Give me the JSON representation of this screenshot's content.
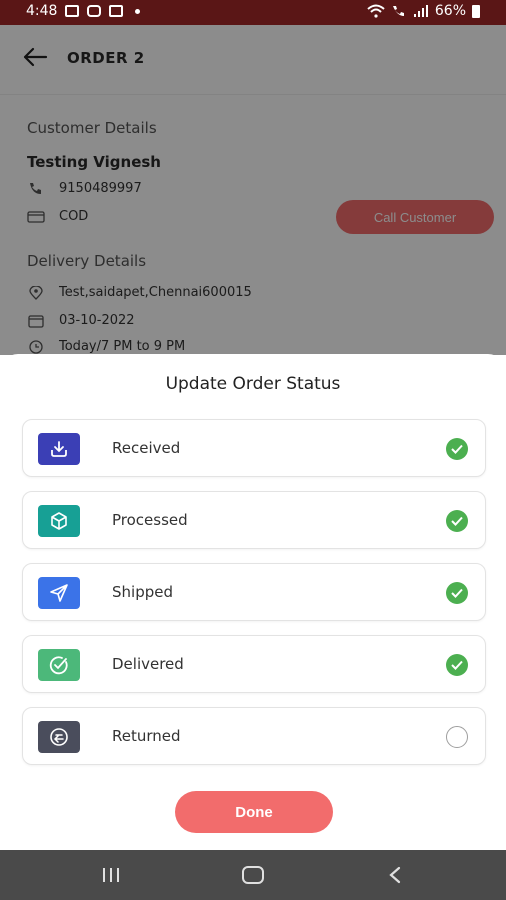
{
  "status_bar": {
    "time": "4:48",
    "battery": "66%"
  },
  "header": {
    "title": "ORDER 2"
  },
  "customer": {
    "section_title": "Customer Details",
    "name": "Testing Vignesh",
    "phone": "9150489997",
    "payment": "COD",
    "call_button": "Call Customer"
  },
  "delivery": {
    "section_title": "Delivery Details",
    "address": "Test,saidapet,Chennai600015",
    "date": "03-10-2022",
    "slot": "Today/7 PM to 9 PM"
  },
  "sheet": {
    "title": "Update Order Status",
    "options": [
      {
        "label": "Received",
        "icon": "download-tray-icon",
        "color": "#3b3fb5",
        "checked": true
      },
      {
        "label": "Processed",
        "icon": "box-icon",
        "color": "#17a095",
        "checked": true
      },
      {
        "label": "Shipped",
        "icon": "send-icon",
        "color": "#3b73e8",
        "checked": true
      },
      {
        "label": "Delivered",
        "icon": "check-circle-icon",
        "color": "#4cb87a",
        "checked": true
      },
      {
        "label": "Returned",
        "icon": "return-icon",
        "color": "#4a4d5c",
        "checked": false
      }
    ],
    "done_button": "Done"
  },
  "colors": {
    "accent": "#f26c6c",
    "status_bar": "#5a1616",
    "check_green": "#4caf50"
  }
}
